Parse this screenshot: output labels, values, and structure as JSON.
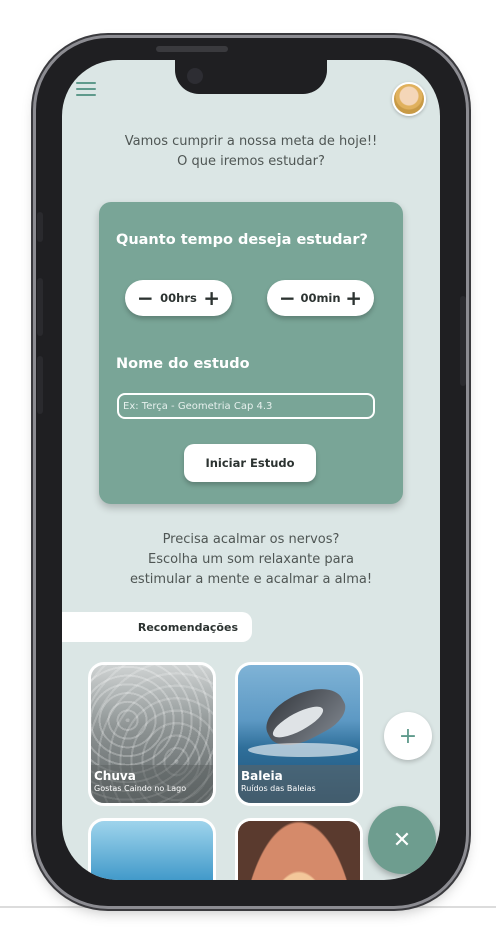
{
  "header": {
    "menu_icon": "hamburger-menu-icon",
    "avatar_icon": "user-avatar"
  },
  "intro": {
    "line1": "Vamos cumprir a nossa meta de hoje!!",
    "line2": "O que iremos estudar?"
  },
  "study_card": {
    "title": "Quanto tempo deseja estudar?",
    "hours": {
      "minus": "−",
      "value": "00hrs",
      "plus": "+"
    },
    "minutes": {
      "minus": "−",
      "value": "00min",
      "plus": "+"
    },
    "name_label": "Nome do estudo",
    "name_placeholder": "Ex: Terça - Geometria Cap 4.3",
    "start_button": "Iniciar Estudo",
    "accent_color": "#79a597"
  },
  "relax": {
    "line1": "Precisa acalmar os nervos?",
    "line2": "Escolha um som relaxante para",
    "line3": "estimular a mente e acalmar a alma!"
  },
  "recommendations": {
    "label": "Recomendações",
    "items": [
      {
        "title": "Chuva",
        "subtitle": "Gostas Caindo no Lago"
      },
      {
        "title": "Baleia",
        "subtitle": "Ruídos das Baleias"
      },
      {
        "title": "",
        "subtitle": ""
      },
      {
        "title": "",
        "subtitle": ""
      }
    ]
  },
  "actions": {
    "add_label": "+",
    "close_label": "✕"
  }
}
